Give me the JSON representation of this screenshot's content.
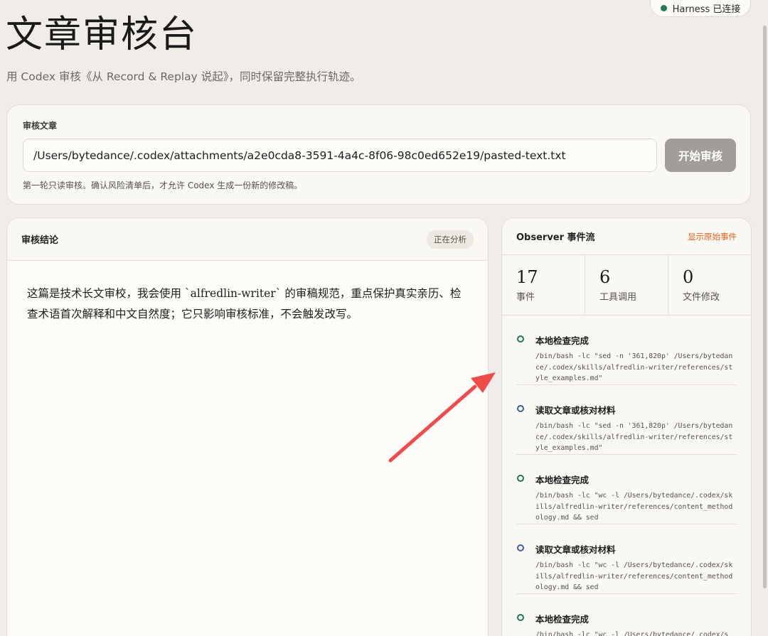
{
  "header": {
    "title": "文章审核台",
    "subtitle": "用 Codex 审核《从 Record & Replay 说起》，同时保留完整执行轨迹。",
    "harness_status": "Harness 已连接"
  },
  "input_card": {
    "label": "审核文章",
    "path_value": "/Users/bytedance/.codex/attachments/a2e0cda8-3591-4a4c-8f06-98c0ed652e19/pasted-text.txt",
    "start_button": "开始审核",
    "hint": "第一轮只读审核。确认风险清单后，才允许 Codex 生成一份新的修改稿。"
  },
  "result": {
    "title": "审核结论",
    "status": "正在分析",
    "body": "这篇是技术长文审校，我会使用 `alfredlin-writer` 的审稿规范，重点保护真实亲历、检查术语首次解释和中文自然度；它只影响审核标准，不会触发改写。"
  },
  "observer": {
    "title": "Observer 事件流",
    "toggle": "显示原始事件",
    "stats": [
      {
        "value": "17",
        "label": "事件"
      },
      {
        "value": "6",
        "label": "工具调用"
      },
      {
        "value": "0",
        "label": "文件修改"
      }
    ],
    "events": [
      {
        "title": "本地检查完成",
        "status": "done",
        "command": "/bin/bash -lc \"sed -n '361,820p' /Users/bytedance/.codex/skills/alfredlin-writer/references/style_examples.md\""
      },
      {
        "title": "读取文章或核对材料",
        "status": "read",
        "command": "/bin/bash -lc \"sed -n '361,820p' /Users/bytedance/.codex/skills/alfredlin-writer/references/style_examples.md\""
      },
      {
        "title": "本地检查完成",
        "status": "done",
        "command": "/bin/bash -lc \"wc -l /Users/bytedance/.codex/skills/alfredlin-writer/references/content_methodology.md && sed"
      },
      {
        "title": "读取文章或核对材料",
        "status": "read",
        "command": "/bin/bash -lc \"wc -l /Users/bytedance/.codex/skills/alfredlin-writer/references/content_methodology.md && sed"
      },
      {
        "title": "本地检查完成",
        "status": "done",
        "command": "/bin/bash -lc \"wc -l /Users/bytedance/.codex/s"
      }
    ]
  },
  "colors": {
    "background": "#f0ede8",
    "card": "#faf8f3",
    "accent_orange": "#e8611a",
    "status_green": "#1f7a56",
    "status_blue": "#3a5fa6",
    "annotation_arrow": "#ef4b4b"
  }
}
